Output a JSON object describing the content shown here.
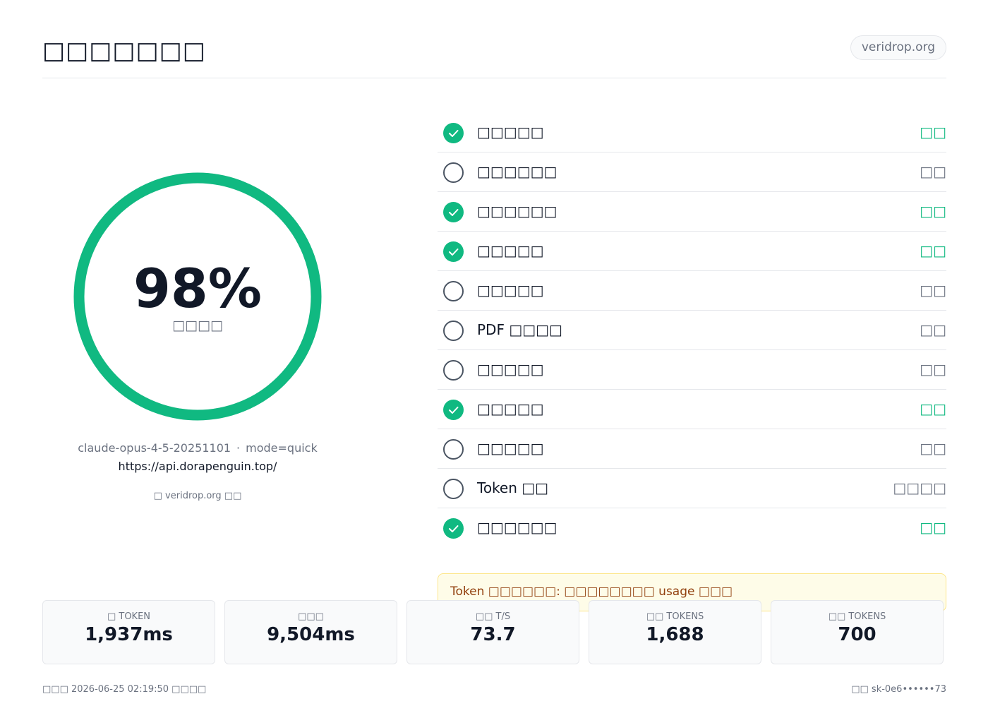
{
  "header": {
    "title": "□□□□□□□",
    "domain": "veridrop.org"
  },
  "score": {
    "value": "98%",
    "percent": 98,
    "label": "□□□□",
    "ring_color": "#10b981"
  },
  "model": {
    "name": "claude-opus-4-5-20251101",
    "separator": "·",
    "mode": "mode=quick",
    "endpoint": "https://api.dorapenguin.top/",
    "powered_by": "□ veridrop.org □□"
  },
  "checks": [
    {
      "label": "□□□□□",
      "status": "□□",
      "state": "pass"
    },
    {
      "label": "□□□□□□",
      "status": "□□",
      "state": "fail"
    },
    {
      "label": "□□□□□□",
      "status": "□□",
      "state": "pass"
    },
    {
      "label": "□□□□□",
      "status": "□□",
      "state": "pass"
    },
    {
      "label": "□□□□□",
      "status": "□□",
      "state": "fail"
    },
    {
      "label": "PDF □□□□",
      "status": "□□",
      "state": "fail"
    },
    {
      "label": "□□□□□",
      "status": "□□",
      "state": "fail"
    },
    {
      "label": "□□□□□",
      "status": "□□",
      "state": "pass"
    },
    {
      "label": "□□□□□",
      "status": "□□",
      "state": "fail"
    },
    {
      "label": "Token □□",
      "status": "□□□□",
      "state": "fail"
    },
    {
      "label": "□□□□□□",
      "status": "□□",
      "state": "pass"
    }
  ],
  "notice": "Token □□□□□□: □□□□□□□□ usage □□□",
  "stats": [
    {
      "label": "□ TOKEN",
      "value": "1,937ms"
    },
    {
      "label": "□□□",
      "value": "9,504ms"
    },
    {
      "label": "□□ T/S",
      "value": "73.7"
    },
    {
      "label": "□□ TOKENS",
      "value": "1,688"
    },
    {
      "label": "□□ TOKENS",
      "value": "700"
    }
  ],
  "footer": {
    "left": "□□□ 2026-06-25 02:19:50 □□□□",
    "right": "□□ sk-0e6••••••73"
  },
  "colors": {
    "pass": "#10b981",
    "fail": "#6b7280",
    "notice_bg": "#fefce8",
    "notice_text": "#92400e"
  }
}
